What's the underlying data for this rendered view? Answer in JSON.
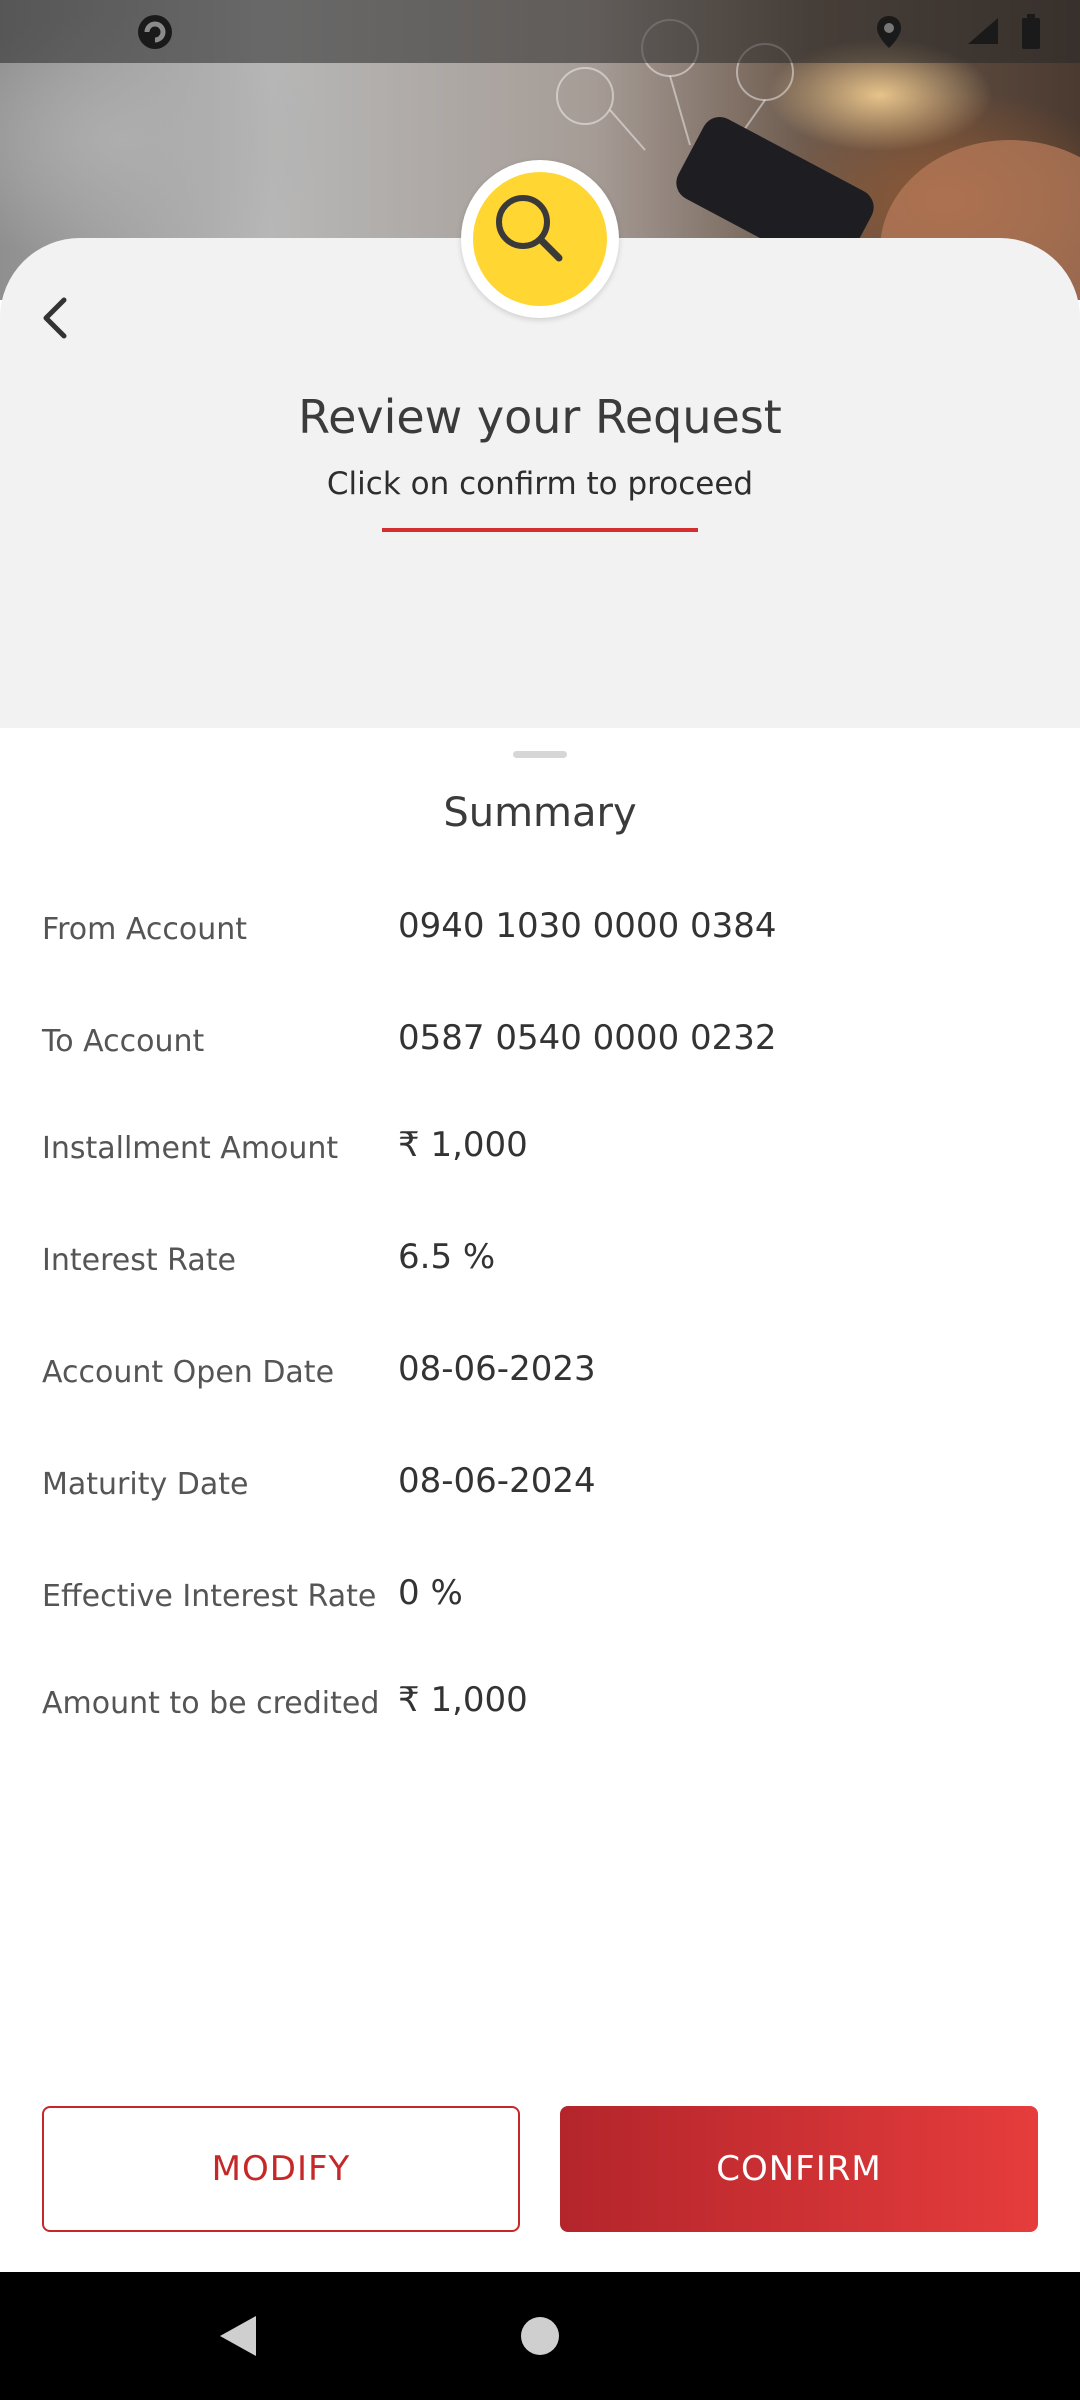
{
  "header": {
    "title": "Review your Request",
    "subtitle": "Click on confirm to proceed"
  },
  "summary": {
    "title": "Summary",
    "rows": [
      {
        "label": "From Account",
        "value": "0940 1030 0000 0384"
      },
      {
        "label": "To Account",
        "value": "0587 0540 0000 0232"
      },
      {
        "label": "Installment Amount",
        "value": "₹ 1,000"
      },
      {
        "label": "Interest Rate",
        "value": "6.5 %"
      },
      {
        "label": "Account Open Date",
        "value": "08-06-2023"
      },
      {
        "label": "Maturity Date",
        "value": "08-06-2024"
      },
      {
        "label": "Effective Interest Rate",
        "value": "0 %"
      },
      {
        "label": "Amount to be credited",
        "value": "₹ 1,000"
      }
    ]
  },
  "actions": {
    "modify_label": "MODIFY",
    "confirm_label": "CONFIRM"
  },
  "colors": {
    "accent": "#d32f2f",
    "confirm_gradient_start": "#b3252b",
    "confirm_gradient_end": "#e63c3c",
    "badge_yellow": "#ffd632",
    "card_background": "#f2f2f2"
  },
  "icons": {
    "status_app": "app-notification-icon",
    "status_location": "location-pin-icon",
    "status_signal": "signal-icon",
    "status_battery": "battery-icon",
    "badge": "search-icon",
    "back": "chevron-left-icon",
    "nav_back": "nav-back-triangle-icon",
    "nav_home": "nav-home-circle-icon"
  }
}
